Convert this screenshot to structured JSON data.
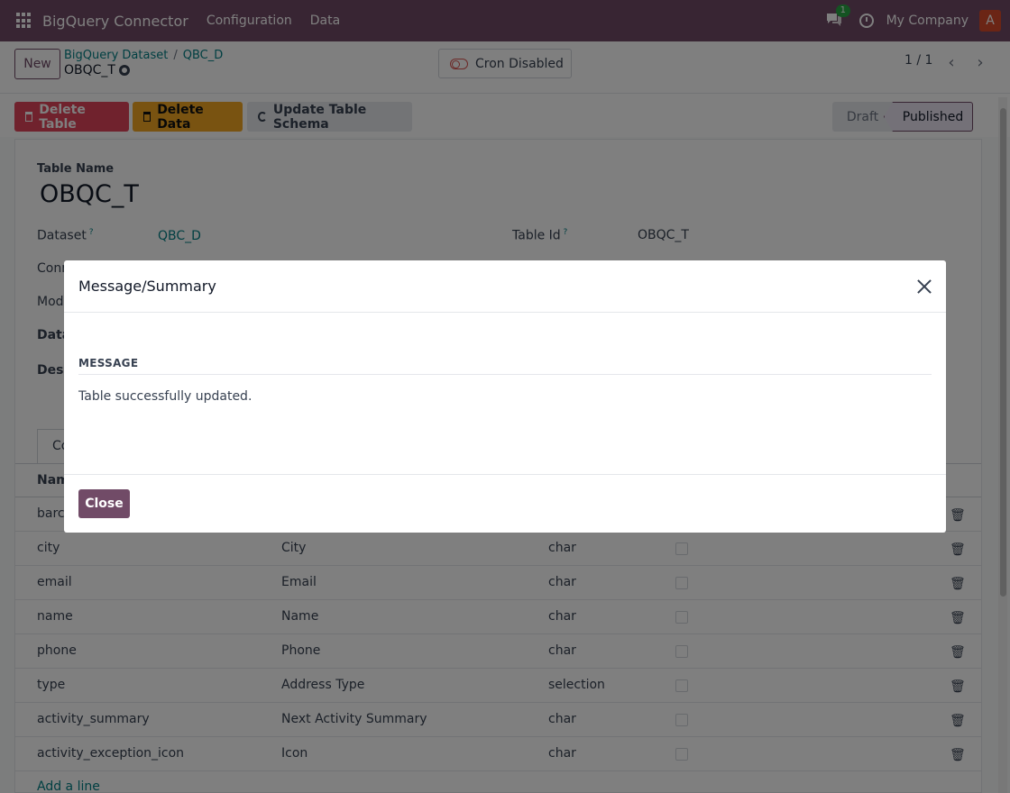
{
  "navbar": {
    "app_name": "BigQuery Connector",
    "menus": [
      "Configuration",
      "Data"
    ],
    "chat_badge": "1",
    "company": "My Company",
    "avatar_letter": "A"
  },
  "control": {
    "new_label": "New",
    "breadcrumb": {
      "parent": "BigQuery Dataset",
      "separator": "/",
      "middle": "QBC_D",
      "current": "OBQC_T"
    },
    "cron_label": "Cron Disabled",
    "pager": "1 / 1"
  },
  "actions": {
    "delete_table": "Delete Table",
    "delete_data": "Delete Data",
    "update_schema": "Update Table Schema"
  },
  "status": {
    "draft": "Draft",
    "published": "Published"
  },
  "form": {
    "table_name_label": "Table Name",
    "table_name": "OBQC_T",
    "dataset_label": "Dataset",
    "dataset_value": "QBC_D",
    "table_id_label": "Table Id",
    "table_id_value": "OBQC_T",
    "conn_label": "Conn",
    "mod_label": "Mod",
    "data_label": "Data",
    "desc_label": "Desc",
    "tab_label": "Co",
    "col_header": "Nam"
  },
  "rows": [
    {
      "name": "barc",
      "label": "",
      "type": ""
    },
    {
      "name": "city",
      "label": "City",
      "type": "char"
    },
    {
      "name": "email",
      "label": "Email",
      "type": "char"
    },
    {
      "name": "name",
      "label": "Name",
      "type": "char"
    },
    {
      "name": "phone",
      "label": "Phone",
      "type": "char"
    },
    {
      "name": "type",
      "label": "Address Type",
      "type": "selection"
    },
    {
      "name": "activity_summary",
      "label": "Next Activity Summary",
      "type": "char"
    },
    {
      "name": "activity_exception_icon",
      "label": "Icon",
      "type": "char"
    }
  ],
  "add_line": "Add a line",
  "modal": {
    "title": "Message/Summary",
    "section_label": "MESSAGE",
    "message": "Table successfully updated.",
    "close_label": "Close"
  },
  "colors": {
    "navbar": "#714b67",
    "primary": "#714b67",
    "danger": "#e0455a",
    "warning": "#f3a623",
    "link": "#017e84"
  }
}
